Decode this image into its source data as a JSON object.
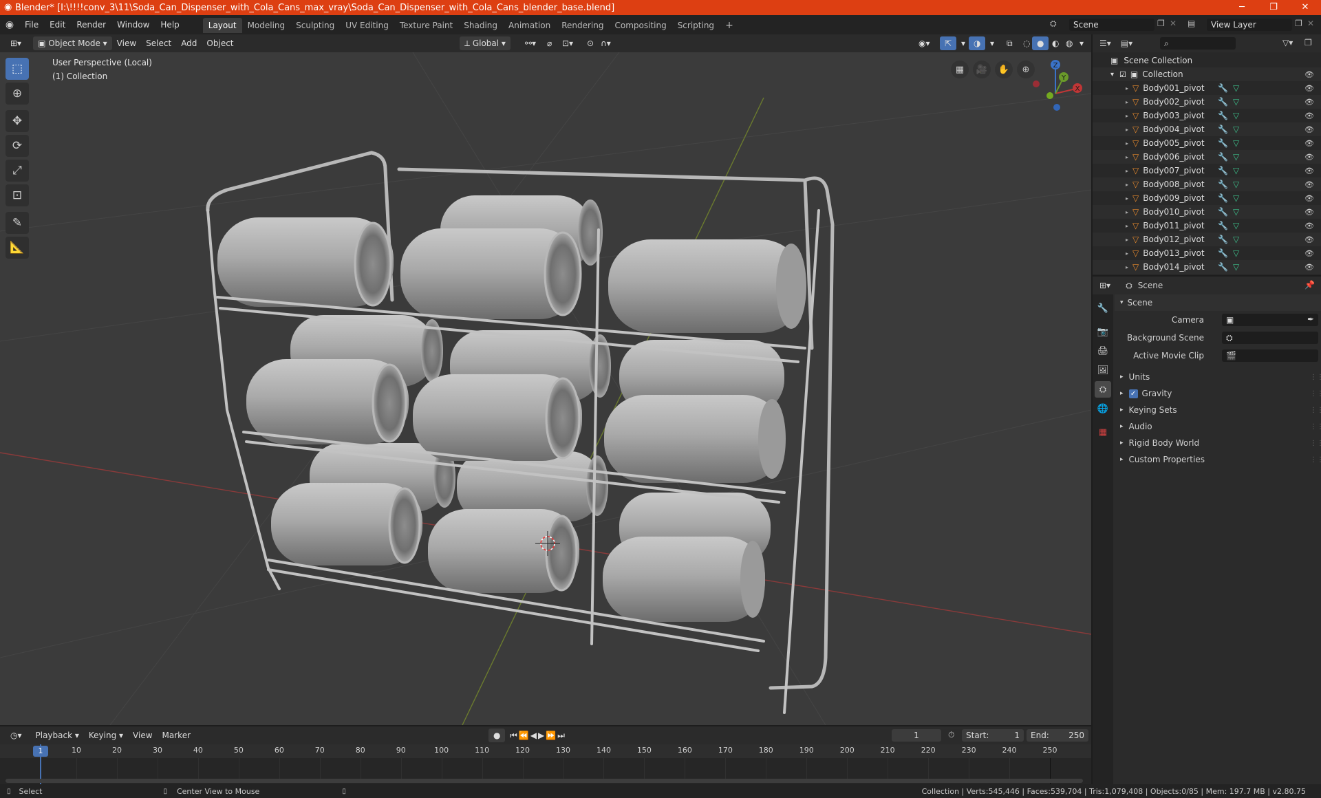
{
  "window": {
    "title": "Blender* [I:\\!!!!conv_3\\11\\Soda_Can_Dispenser_with_Cola_Cans_max_vray\\Soda_Can_Dispenser_with_Cola_Cans_blender_base.blend]",
    "accent": "#dd3f12"
  },
  "menu": {
    "items": [
      "File",
      "Edit",
      "Render",
      "Window",
      "Help"
    ],
    "workspaces": [
      "Layout",
      "Modeling",
      "Sculpting",
      "UV Editing",
      "Texture Paint",
      "Shading",
      "Animation",
      "Rendering",
      "Compositing",
      "Scripting"
    ],
    "active_workspace": "Layout",
    "scene": "Scene",
    "view_layer": "View Layer"
  },
  "viewport_header": {
    "mode": "Object Mode",
    "menus": [
      "View",
      "Select",
      "Add",
      "Object"
    ],
    "orientation": "Global"
  },
  "viewport": {
    "perspective": "User Perspective (Local)",
    "collection": "(1) Collection",
    "gizmo": {
      "z": "Z",
      "y": "Y",
      "x": "X"
    }
  },
  "outliner": {
    "search_placeholder": "",
    "root": "Scene Collection",
    "collection": "Collection",
    "items": [
      "Body001_pivot",
      "Body002_pivot",
      "Body003_pivot",
      "Body004_pivot",
      "Body005_pivot",
      "Body006_pivot",
      "Body007_pivot",
      "Body008_pivot",
      "Body009_pivot",
      "Body010_pivot",
      "Body011_pivot",
      "Body012_pivot",
      "Body013_pivot",
      "Body014_pivot"
    ]
  },
  "properties": {
    "context": "Scene",
    "panel": "Scene",
    "camera_label": "Camera",
    "background_scene_label": "Background Scene",
    "movie_clip_label": "Active Movie Clip",
    "sections": [
      "Units",
      "Gravity",
      "Keying Sets",
      "Audio",
      "Rigid Body World",
      "Custom Properties"
    ]
  },
  "timeline": {
    "menus": [
      "Playback",
      "Keying",
      "View",
      "Marker"
    ],
    "current_frame": "1",
    "start_label": "Start:",
    "start": "1",
    "end_label": "End:",
    "end": "250",
    "ruler": [
      "1",
      "10",
      "20",
      "30",
      "40",
      "50",
      "60",
      "70",
      "80",
      "90",
      "100",
      "110",
      "120",
      "130",
      "140",
      "150",
      "160",
      "170",
      "180",
      "190",
      "200",
      "210",
      "220",
      "230",
      "240",
      "250"
    ]
  },
  "status": {
    "left": "Select",
    "middle": "Center View to Mouse",
    "right": "Collection | Verts:545,446 | Faces:539,704 | Tris:1,079,408 | Objects:0/85 | Mem: 197.7 MB | v2.80.75"
  }
}
